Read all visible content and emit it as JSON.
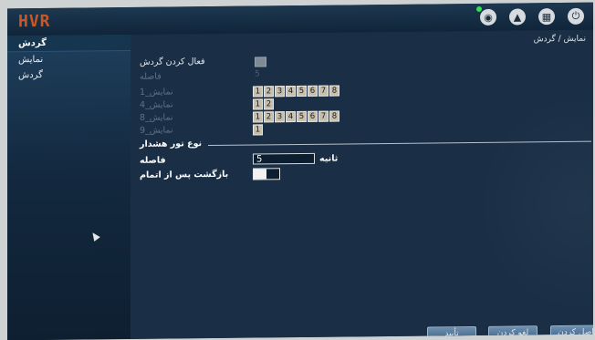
{
  "logo": "HVR",
  "top_icons": [
    "eye-icon",
    "lock-icon",
    "grid-icon",
    "power-icon"
  ],
  "sidebar": {
    "title": "گردش",
    "items": [
      {
        "label": "نمایش"
      },
      {
        "label": "گردش"
      }
    ]
  },
  "breadcrumb": "نمایش / گردش",
  "form": {
    "enable_label": "فعال کردن گردش",
    "interval_label": "فاصله",
    "interval_value": "5",
    "views": [
      {
        "label": "نمایش_1",
        "cells": [
          "1",
          "2",
          "3",
          "4",
          "5",
          "6",
          "7",
          "8"
        ]
      },
      {
        "label": "نمایش_4",
        "cells": [
          "1",
          "2"
        ]
      },
      {
        "label": "نمایش_8",
        "cells": [
          "1",
          "2",
          "3",
          "4",
          "5",
          "6",
          "7",
          "8"
        ]
      },
      {
        "label": "نمایش_9",
        "cells": [
          "1"
        ]
      }
    ],
    "alarm_section": "نوع تور هشدار",
    "alarm_interval_label": "فاصله",
    "alarm_interval_value": "5",
    "alarm_interval_unit": "ثانیه",
    "return_label": "بازگشت پس از اتمام"
  },
  "buttons": {
    "default": "اصل کردن",
    "apply": "لغو کردن",
    "ok": "تأیید"
  }
}
